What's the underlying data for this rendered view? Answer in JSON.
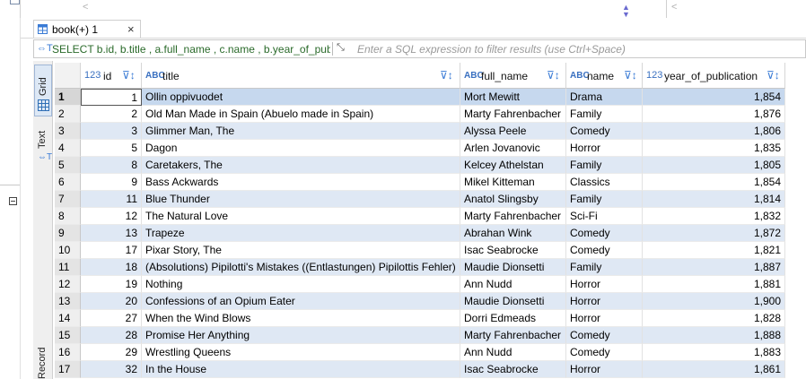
{
  "tab": {
    "label": "book(+) 1",
    "close": "×"
  },
  "filter": {
    "query": "SELECT b.id, b.title , a.full_name , c.name , b.year_of_public",
    "placeholder": "Enter a SQL expression to filter results (use Ctrl+Space)"
  },
  "side_tabs": {
    "grid": "Grid",
    "text": "Text",
    "record": "Record"
  },
  "columns": [
    {
      "type": "123",
      "label": "id"
    },
    {
      "type": "ABC",
      "label": "title"
    },
    {
      "type": "ABC",
      "label": "full_name"
    },
    {
      "type": "ABC",
      "label": "name"
    },
    {
      "type": "123",
      "label": "year_of_publication"
    }
  ],
  "rows": [
    {
      "n": "1",
      "id": "1",
      "title": "Ollin oppivuodet",
      "full_name": "Mort Mewitt",
      "name": "Drama",
      "year": "1,854"
    },
    {
      "n": "2",
      "id": "2",
      "title": "Old Man Made in Spain (Abuelo made in Spain)",
      "full_name": "Marty Fahrenbacher",
      "name": "Family",
      "year": "1,876"
    },
    {
      "n": "3",
      "id": "3",
      "title": "Glimmer Man, The",
      "full_name": "Alyssa Peele",
      "name": "Comedy",
      "year": "1,806"
    },
    {
      "n": "4",
      "id": "5",
      "title": "Dagon",
      "full_name": "Arlen Jovanovic",
      "name": "Horror",
      "year": "1,835"
    },
    {
      "n": "5",
      "id": "8",
      "title": "Caretakers, The",
      "full_name": "Kelcey Athelstan",
      "name": "Family",
      "year": "1,805"
    },
    {
      "n": "6",
      "id": "9",
      "title": "Bass Ackwards",
      "full_name": "Mikel Kitteman",
      "name": "Classics",
      "year": "1,854"
    },
    {
      "n": "7",
      "id": "11",
      "title": "Blue Thunder",
      "full_name": "Anatol Slingsby",
      "name": "Family",
      "year": "1,814"
    },
    {
      "n": "8",
      "id": "12",
      "title": "The Natural Love",
      "full_name": "Marty Fahrenbacher",
      "name": "Sci-Fi",
      "year": "1,832"
    },
    {
      "n": "9",
      "id": "13",
      "title": "Trapeze",
      "full_name": "Abrahan Wink",
      "name": "Comedy",
      "year": "1,872"
    },
    {
      "n": "10",
      "id": "17",
      "title": "Pixar Story, The",
      "full_name": "Isac Seabrocke",
      "name": "Comedy",
      "year": "1,821"
    },
    {
      "n": "11",
      "id": "18",
      "title": "(Absolutions) Pipilotti's Mistakes ((Entlastungen) Pipilottis Fehler)",
      "full_name": "Maudie Dionsetti",
      "name": "Family",
      "year": "1,887"
    },
    {
      "n": "12",
      "id": "19",
      "title": "Nothing",
      "full_name": "Ann Nudd",
      "name": "Horror",
      "year": "1,881"
    },
    {
      "n": "13",
      "id": "20",
      "title": "Confessions of an Opium Eater",
      "full_name": "Maudie Dionsetti",
      "name": "Horror",
      "year": "1,900"
    },
    {
      "n": "14",
      "id": "27",
      "title": "When the Wind Blows",
      "full_name": "Dorri Edmeads",
      "name": "Horror",
      "year": "1,828"
    },
    {
      "n": "15",
      "id": "28",
      "title": "Promise Her Anything",
      "full_name": "Marty Fahrenbacher",
      "name": "Comedy",
      "year": "1,888"
    },
    {
      "n": "16",
      "id": "29",
      "title": "Wrestling Queens",
      "full_name": "Ann Nudd",
      "name": "Comedy",
      "year": "1,883"
    },
    {
      "n": "17",
      "id": "32",
      "title": "In the House",
      "full_name": "Isac Seabrocke",
      "name": "Horror",
      "year": "1,861"
    }
  ],
  "colors": {
    "accent": "#3a7bd5",
    "row_alt": "#dfe8f4",
    "row_selected": "#c6d8ee"
  },
  "icons": [
    "filter-icon",
    "sort-filter-icon",
    "expand-icon",
    "grid-icon",
    "text-icon",
    "close-icon",
    "table-icon"
  ]
}
